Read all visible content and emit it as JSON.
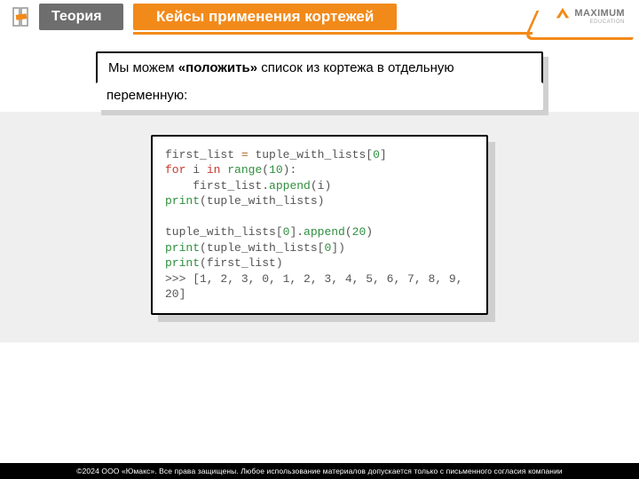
{
  "header": {
    "badge": "Теория",
    "title": "Кейсы применения кортежей",
    "logo_text": "MAXIMUM",
    "logo_sub": "EDUCATION"
  },
  "callout": {
    "line1_a": "Мы можем ",
    "line1_b": "«положить»",
    "line1_c": " список из кортежа в отдельную",
    "line2": "переменную:"
  },
  "code": {
    "l1a": "first_list ",
    "l1b": "=",
    "l1c": " tuple_with_lists[",
    "l1d": "0",
    "l1e": "]",
    "l2a": "for",
    "l2b": " i ",
    "l2c": "in",
    "l2d": " ",
    "l2e": "range",
    "l2f": "(",
    "l2g": "10",
    "l2h": "):",
    "l3a": "    first_list.",
    "l3b": "append",
    "l3c": "(i)",
    "l4a": "print",
    "l4b": "(tuple_with_lists)",
    "blank": "",
    "l6a": "tuple_with_lists[",
    "l6b": "0",
    "l6c": "].",
    "l6d": "append",
    "l6e": "(",
    "l6f": "20",
    "l6g": ")",
    "l7a": "print",
    "l7b": "(tuple_with_lists[",
    "l7c": "0",
    "l7d": "])",
    "l8a": "print",
    "l8b": "(first_list)",
    "l9": ">>> [1, 2, 3, 0, 1, 2, 3, 4, 5, 6, 7, 8, 9, 20]"
  },
  "footer": "©2024 ООО «Юмакс». Все права защищены. Любое использование материалов допускается только с письменного согласия компании"
}
